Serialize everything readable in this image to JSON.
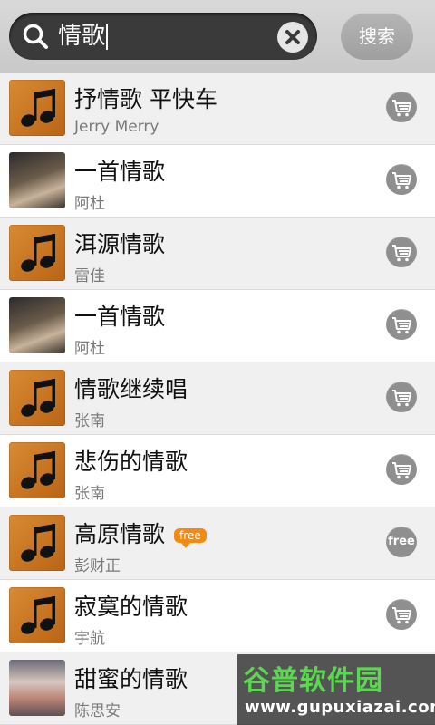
{
  "search": {
    "query": "情歌",
    "button_label": "搜索"
  },
  "songs": [
    {
      "title": "抒情歌 平快车",
      "artist": "Jerry Merry",
      "art": "note",
      "action": "cart"
    },
    {
      "title": "一首情歌",
      "artist": "阿杜",
      "art": "photo",
      "action": "cart"
    },
    {
      "title": "洱源情歌",
      "artist": "雷佳",
      "art": "note",
      "action": "cart"
    },
    {
      "title": "一首情歌",
      "artist": "阿杜",
      "art": "photo",
      "action": "cart"
    },
    {
      "title": "情歌继续唱",
      "artist": "张南",
      "art": "note",
      "action": "cart"
    },
    {
      "title": "悲伤的情歌",
      "artist": "张南",
      "art": "note",
      "action": "cart"
    },
    {
      "title": "高原情歌",
      "artist": "彭财正",
      "art": "note",
      "action": "free",
      "tag": "free",
      "action_label": "free"
    },
    {
      "title": "寂寞的情歌",
      "artist": "宇航",
      "art": "note",
      "action": "cart"
    },
    {
      "title": "甜蜜的情歌",
      "artist": "陈思安",
      "art": "photo",
      "action": "none"
    }
  ],
  "watermark": {
    "title": "谷普软件园",
    "url": "www.gupuxiazai.com"
  },
  "colors": {
    "accent_free": "#f28a14",
    "note_art": "#c87426",
    "watermark_green": "#5ad84f"
  }
}
